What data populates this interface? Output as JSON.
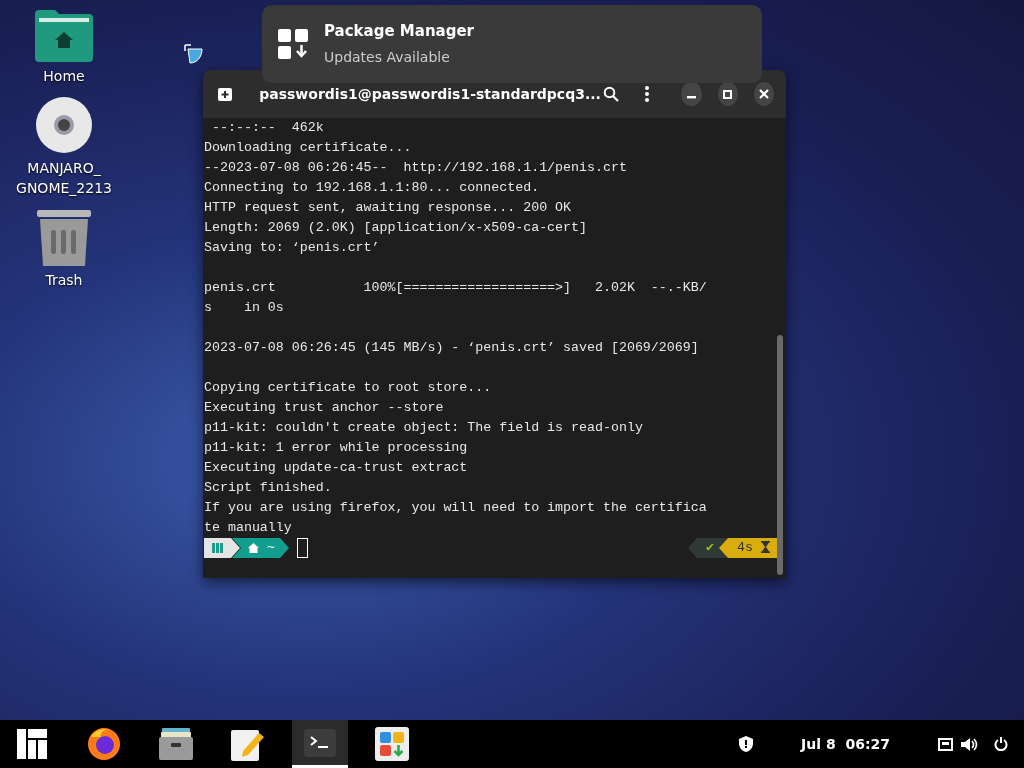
{
  "desktop_icons": [
    {
      "kind": "folder",
      "label_lines": [
        "Home"
      ]
    },
    {
      "kind": "disc",
      "label_lines": [
        "MANJARO_",
        "GNOME_2213"
      ]
    },
    {
      "kind": "trash",
      "label_lines": [
        "Trash"
      ]
    }
  ],
  "notification": {
    "title": "Package Manager",
    "body": "Updates Available"
  },
  "terminal": {
    "title": "passwordis1@passwordis1-standardpcq3...",
    "lines": [
      " --:--:--  462k",
      "Downloading certificate...",
      "--2023-07-08 06:26:45--  http://192.168.1.1/penis.crt",
      "Connecting to 192.168.1.1:80... connected.",
      "HTTP request sent, awaiting response... 200 OK",
      "Length: 2069 (2.0K) [application/x-x509-ca-cert]",
      "Saving to: ‘penis.crt’",
      {
        "kind": "blank"
      },
      "penis.crt           100%[===================>]   2.02K  --.-KB/",
      "s    in 0s",
      {
        "kind": "blank"
      },
      "2023-07-08 06:26:45 (145 MB/s) - ‘penis.crt’ saved [2069/2069]",
      {
        "kind": "blank"
      },
      "Copying certificate to root store...",
      "Executing trust anchor --store",
      "p11-kit: couldn't create object: The field is read-only",
      "p11-kit: 1 error while processing",
      "Executing update-ca-trust extract",
      "Script finished.",
      "If you are using firefox, you will need to import the certifica",
      "te manually"
    ],
    "prompt": {
      "dir": "~",
      "status": "✔",
      "duration": "4s"
    }
  },
  "taskbar": {
    "apps": [
      {
        "kind": "menu",
        "selected": false
      },
      {
        "kind": "firefox",
        "selected": false
      },
      {
        "kind": "files",
        "selected": false
      },
      {
        "kind": "editor",
        "selected": false
      },
      {
        "kind": "terminal",
        "selected": true
      },
      {
        "kind": "software",
        "selected": false
      }
    ],
    "clock": "Jul 8  06:27"
  }
}
